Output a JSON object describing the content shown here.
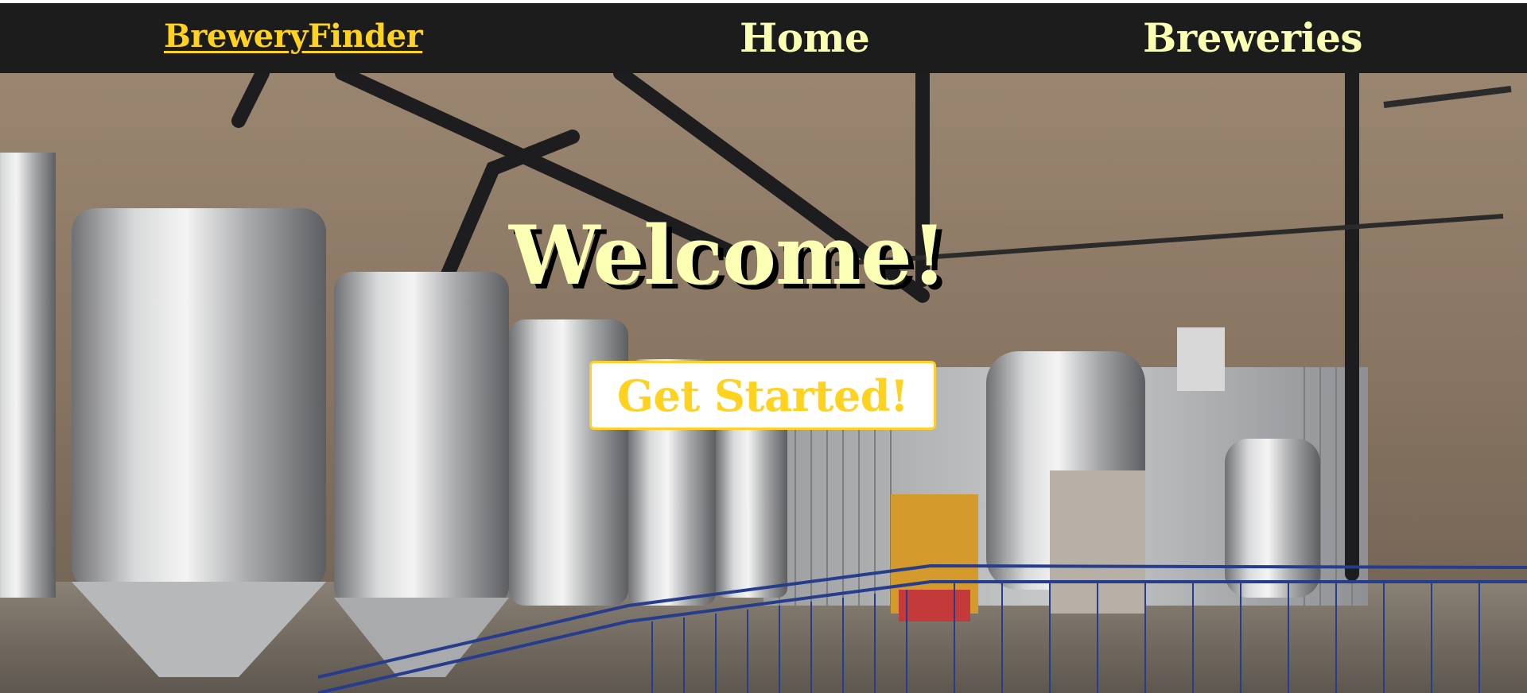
{
  "navbar": {
    "brand": "BreweryFinder",
    "links": [
      {
        "label": "Home"
      },
      {
        "label": "Breweries"
      }
    ]
  },
  "hero": {
    "heading": "Welcome!",
    "cta_label": "Get Started!",
    "background_image": "brewery-interior-photo"
  },
  "colors": {
    "navbar_bg": "#1c1c1c",
    "brand": "#ffd21f",
    "nav_link": "#fbffb3",
    "heading": "#fbffb3",
    "cta_text": "#ffd21f",
    "cta_border": "#ffcf2e"
  }
}
